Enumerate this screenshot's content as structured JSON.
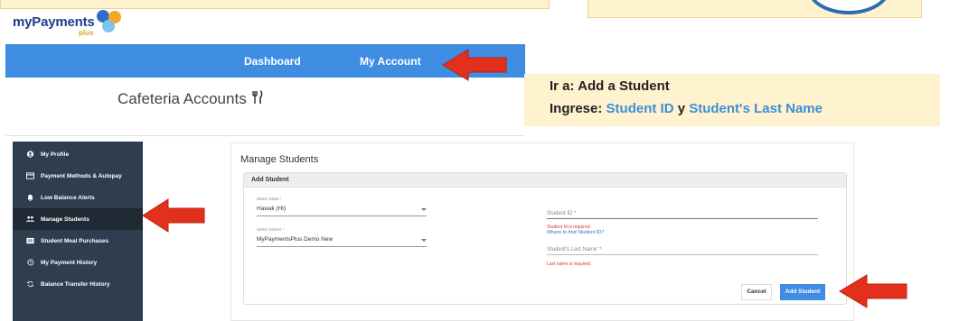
{
  "logo": {
    "text": "myPayments",
    "plus": "plus"
  },
  "nav": {
    "dashboard": "Dashboard",
    "my_account": "My Account"
  },
  "page": {
    "title": "Cafeteria Accounts"
  },
  "instructions": {
    "line1": "Ir a: Add a Student",
    "line2_prefix": "Ingrese: ",
    "line2_field1": "Student ID",
    "line2_join": " y ",
    "line2_field2": "Student's Last Name"
  },
  "sidebar": {
    "items": [
      {
        "label": "My Profile",
        "icon": "user-circle-icon"
      },
      {
        "label": "Payment Methods & Autopay",
        "icon": "credit-card-icon"
      },
      {
        "label": "Low Balance Alerts",
        "icon": "bell-icon"
      },
      {
        "label": "Manage Students",
        "icon": "students-icon",
        "active": true
      },
      {
        "label": "Student Meal Purchases",
        "icon": "receipt-icon"
      },
      {
        "label": "My Payment History",
        "icon": "history-icon"
      },
      {
        "label": "Balance Transfer History",
        "icon": "transfer-icon"
      }
    ]
  },
  "manage": {
    "title": "Manage Students",
    "card_title": "Add Student",
    "state_label": "Select State *",
    "state_value": "Hawaii (HI)",
    "district_label": "Select District *",
    "district_value": "MyPaymentsPlus Demo New",
    "student_id_placeholder": "Student ID *",
    "student_id_error": "Student Id is required.",
    "student_id_help": "Where to find Student ID?",
    "last_name_placeholder": "Student's Last Name' *",
    "last_name_error": "Last name is required.",
    "cancel": "Cancel",
    "add_student": "Add Student"
  },
  "colors": {
    "accent": "#3e8de3",
    "sidebar": "#2f3e4e",
    "arrow": "#e3301c",
    "highlight_bg": "#fff3cf"
  }
}
